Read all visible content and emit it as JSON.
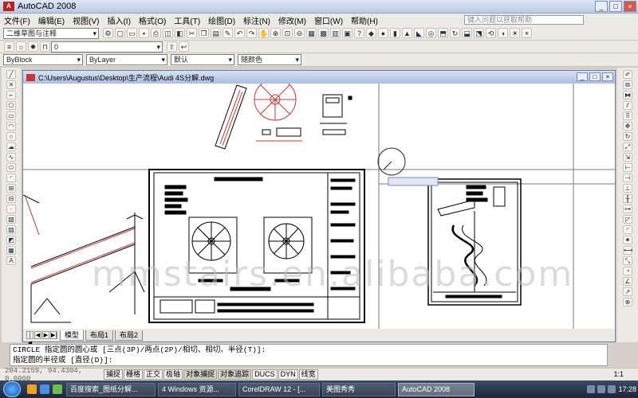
{
  "window": {
    "title": "AutoCAD 2008",
    "controls": [
      "_",
      "□",
      "×"
    ]
  },
  "menu": {
    "items": [
      "文件(F)",
      "编辑(E)",
      "视图(V)",
      "插入(I)",
      "格式(O)",
      "工具(T)",
      "绘图(D)",
      "标注(N)",
      "修改(M)",
      "窗口(W)",
      "帮助(H)"
    ],
    "help_placeholder": "键入问题以获取帮助"
  },
  "toolbar": {
    "workspace": "二维草图与注释",
    "layer_value": "0",
    "color": "ByBlock",
    "linetype": "ByLayer",
    "lineweight": "默认",
    "plotstyle": "随颜色"
  },
  "drawing": {
    "path": "C:\\Users\\Augustus\\Desktop\\生产流程\\Audi 4S分解.dwg",
    "controls": [
      "_",
      "□",
      "×"
    ]
  },
  "tabs": {
    "items": [
      "模型",
      "布局1",
      "布局2"
    ],
    "nav": [
      "|◀",
      "◀",
      "▶",
      "▶|"
    ]
  },
  "command": {
    "line1": "CIRCLE 指定圆的圆心或 [三点(3P)/两点(2P)/相切、相切、半径(T)]:",
    "line2": "指定圆的半径或 [直径(D)]:"
  },
  "status": {
    "coords": "204.2159, 94.4304, 0.0000",
    "buttons": [
      "捕捉",
      "栅格",
      "正交",
      "极轴",
      "对象捕捉",
      "对象追踪",
      "DUCS",
      "DYN",
      "线宽"
    ],
    "scale": "1:1"
  },
  "taskbar": {
    "tasks": [
      "百度搜索_图纸分解...",
      "4 Windows 资源...",
      "CorelDRAW 12 - [...",
      "美图秀秀",
      "AutoCAD 2008"
    ],
    "clock": "17:28"
  },
  "watermark": "mmstairs.en.alibaba.com",
  "colors": {
    "title_grad": "#b9c9e2",
    "drawing_red": "#c0392b",
    "taskbar": "#1b2637"
  }
}
